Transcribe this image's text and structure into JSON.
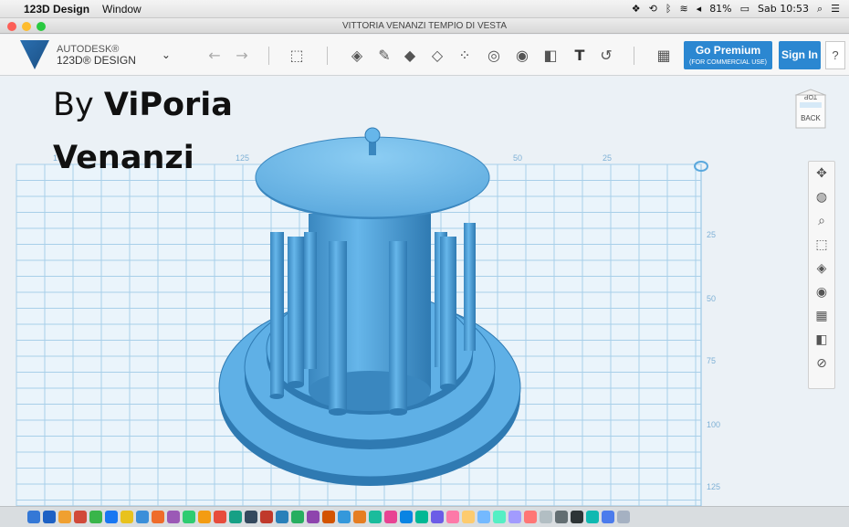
{
  "menubar": {
    "app_name": "123D Design",
    "menu_window": "Window",
    "battery": "81%",
    "clock": "Sab 10:53",
    "status_icons": [
      "dropbox-icon",
      "time-machine-icon",
      "bluetooth-icon",
      "wifi-icon",
      "volume-icon",
      "battery-icon",
      "spotlight-icon",
      "notification-center-icon"
    ]
  },
  "window": {
    "title": "VITTORIA VENANZI TEMPIO DI VESTA"
  },
  "toolbar": {
    "brand_line1": "AUTODESK®",
    "brand_line2": "123D® DESIGN",
    "premium_label": "Go Premium",
    "premium_sub": "(FOR COMMERCIAL USE)",
    "signin_label": "Sign In",
    "help_label": "?"
  },
  "canvas": {
    "credit_prefix": "By ",
    "credit_name_line1": "ViPoria",
    "credit_name_line2": "Venanzi",
    "ruler_top": [
      "17",
      "125",
      "50",
      "25"
    ],
    "ruler_right": [
      "25",
      "50",
      "75",
      "100",
      "125"
    ],
    "viewcube_top": "TOP",
    "viewcube_back": "BACK",
    "colors": {
      "model": "#5fb0e6",
      "model_dark": "#3a87bf",
      "grid": "#9cc8e6",
      "accent": "#2b87d1"
    }
  },
  "right_tools": [
    "pan-icon",
    "orbit-icon",
    "zoom-icon",
    "fit-icon",
    "view-cube-icon",
    "visibility-icon",
    "grid-icon",
    "material-icon",
    "hide-icon"
  ]
}
